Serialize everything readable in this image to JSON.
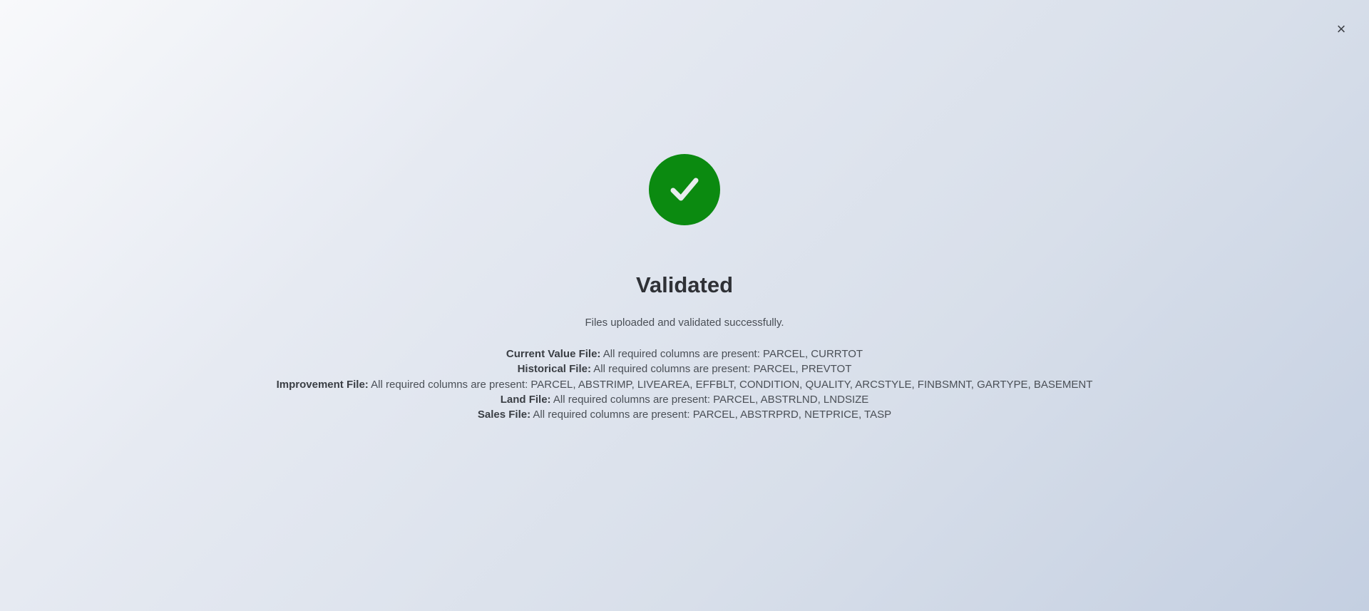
{
  "close": {
    "label": "×",
    "icon": "close-icon"
  },
  "status": {
    "icon": "check-circle-icon",
    "color": "#0b8a10",
    "title": "Validated",
    "message": "Files uploaded and validated successfully."
  },
  "results": [
    {
      "label": "Current Value File:",
      "text": "All required columns are present: PARCEL, CURRTOT"
    },
    {
      "label": "Historical File:",
      "text": "All required columns are present: PARCEL, PREVTOT"
    },
    {
      "label": "Improvement File:",
      "text": "All required columns are present: PARCEL, ABSTRIMP, LIVEAREA, EFFBLT, CONDITION, QUALITY, ARCSTYLE, FINBSMNT, GARTYPE, BASEMENT"
    },
    {
      "label": "Land File:",
      "text": "All required columns are present: PARCEL, ABSTRLND, LNDSIZE"
    },
    {
      "label": "Sales File:",
      "text": "All required columns are present: PARCEL, ABSTRPRD, NETPRICE, TASP"
    }
  ]
}
